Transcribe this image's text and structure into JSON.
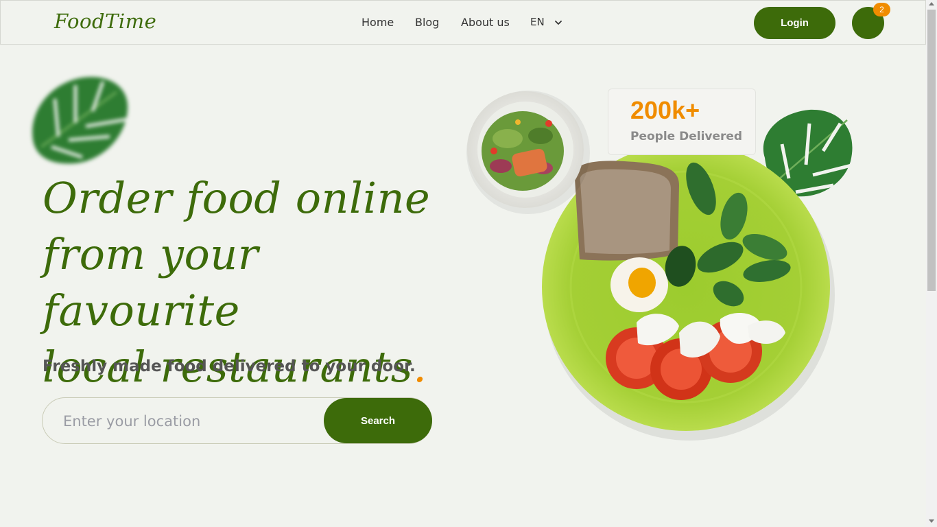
{
  "header": {
    "logo": "FoodTime",
    "nav": {
      "home": "Home",
      "blog": "Blog",
      "about": "About us"
    },
    "language": "EN",
    "login_label": "Login",
    "cart_count": "2"
  },
  "hero": {
    "title_line1": "Order food online",
    "title_line2": "from your favourite",
    "title_line3": "local restaurants",
    "title_dot": ".",
    "subtitle": "Freshly made food delivered to your door.",
    "search_placeholder": "Enter your location",
    "search_value": "",
    "search_button": "Search"
  },
  "stats": {
    "value": "200k+",
    "label": "People Delivered"
  },
  "colors": {
    "brand": "#3d6b0a",
    "accent": "#f08c00",
    "background": "#f1f3ee"
  },
  "icons": [
    "chevron-down-icon",
    "cart-icon",
    "monstera-leaf-icon"
  ]
}
